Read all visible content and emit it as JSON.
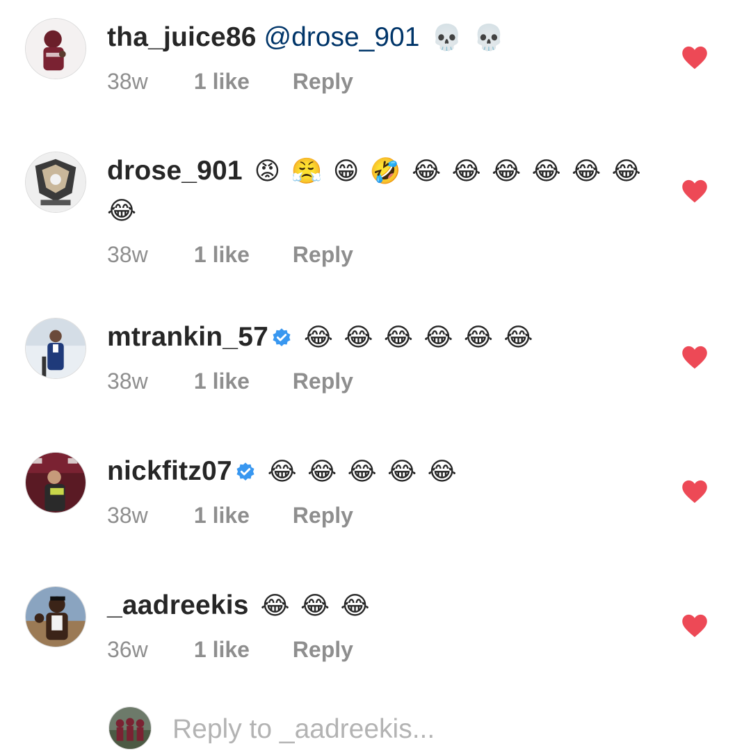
{
  "colors": {
    "heart": "#ed4956",
    "username": "#262626",
    "mention": "#003569",
    "meta": "#8e8e8e",
    "verified": "#3897f0"
  },
  "comments": [
    {
      "username": "tha_juice86",
      "mention": "@drose_901",
      "text": "💀 💀",
      "verified": false,
      "time": "38w",
      "likes": "1 like",
      "reply": "Reply",
      "liked": true
    },
    {
      "username": "drose_901",
      "mention": "",
      "text": "😡 😤 😁 🤣 😂 😂 😂 😂 😂 😂 😂",
      "verified": false,
      "time": "38w",
      "likes": "1 like",
      "reply": "Reply",
      "liked": true
    },
    {
      "username": "mtrankin_57",
      "mention": "",
      "text": "😂 😂 😂 😂 😂 😂",
      "verified": true,
      "time": "38w",
      "likes": "1 like",
      "reply": "Reply",
      "liked": true
    },
    {
      "username": "nickfitz07",
      "mention": "",
      "text": "😂 😂 😂 😂 😂",
      "verified": true,
      "time": "38w",
      "likes": "1 like",
      "reply": "Reply",
      "liked": true
    },
    {
      "username": "_aadreekis",
      "mention": "",
      "text": "😂 😂 😂",
      "verified": false,
      "time": "36w",
      "likes": "1 like",
      "reply": "Reply",
      "liked": true
    }
  ],
  "composer": {
    "placeholder": "Reply to _aadreekis..."
  }
}
